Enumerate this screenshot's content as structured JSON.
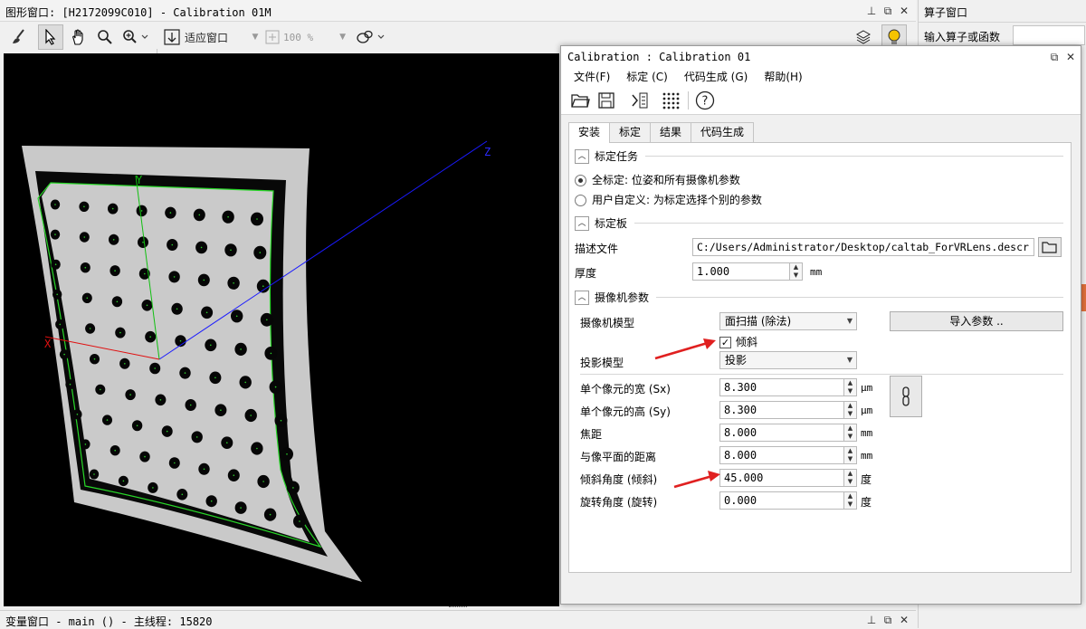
{
  "graphics_window": {
    "title": "图形窗口: [H2172099C010] - Calibration 01M",
    "fit_label": "适应窗口",
    "zoom": "100 %"
  },
  "right_panel": {
    "title": "算子窗口",
    "input_label": "输入算子或函数"
  },
  "bottom_bar": {
    "title": "变量窗口 - main () - 主线程: 15820"
  },
  "axes": {
    "z": "Z",
    "y": "Y",
    "x": "X"
  },
  "dialog": {
    "title": "Calibration : Calibration 01",
    "menu": [
      "文件(F)",
      "标定 (C)",
      "代码生成 (G)",
      "帮助(H)"
    ],
    "tabs": [
      "安装",
      "标定",
      "结果",
      "代码生成"
    ],
    "active_tab": "安装",
    "task_section": "标定任务",
    "task_full": "全标定: 位姿和所有摄像机参数",
    "task_custom": "用户自定义: 为标定选择个别的参数",
    "plate_section": "标定板",
    "desc_label": "描述文件",
    "desc_value": "C:/Users/Administrator/Desktop/caltab_ForVRLens.descr",
    "thickness_label": "厚度",
    "thickness_value": "1.000",
    "thickness_unit": "mm",
    "camera_section": "摄像机参数",
    "camera_model_label": "摄像机模型",
    "camera_model_value": "面扫描 (除法)",
    "import_button": "导入参数 ..",
    "tilt_checkbox": "倾斜",
    "projection_label": "投影模型",
    "projection_value": "投影",
    "sx_label": "单个像元的宽 (Sx)",
    "sx_value": "8.300",
    "sx_unit": "μm",
    "sy_label": "单个像元的高 (Sy)",
    "sy_value": "8.300",
    "sy_unit": "μm",
    "focal_label": "焦距",
    "focal_value": "8.000",
    "focal_unit": "mm",
    "image_dist_label": "与像平面的距离",
    "image_dist_value": "8.000",
    "image_dist_unit": "mm",
    "tilt_label": "倾斜角度 (倾斜)",
    "tilt_value": "45.000",
    "tilt_unit": "度",
    "rot_label": "旋转角度 (旋转)",
    "rot_value": "0.000",
    "rot_unit": "度"
  },
  "colors": {
    "accent_arrow": "#e02020",
    "axis_x": "#e01010",
    "axis_y": "#10c010",
    "axis_z": "#1a1aff"
  }
}
